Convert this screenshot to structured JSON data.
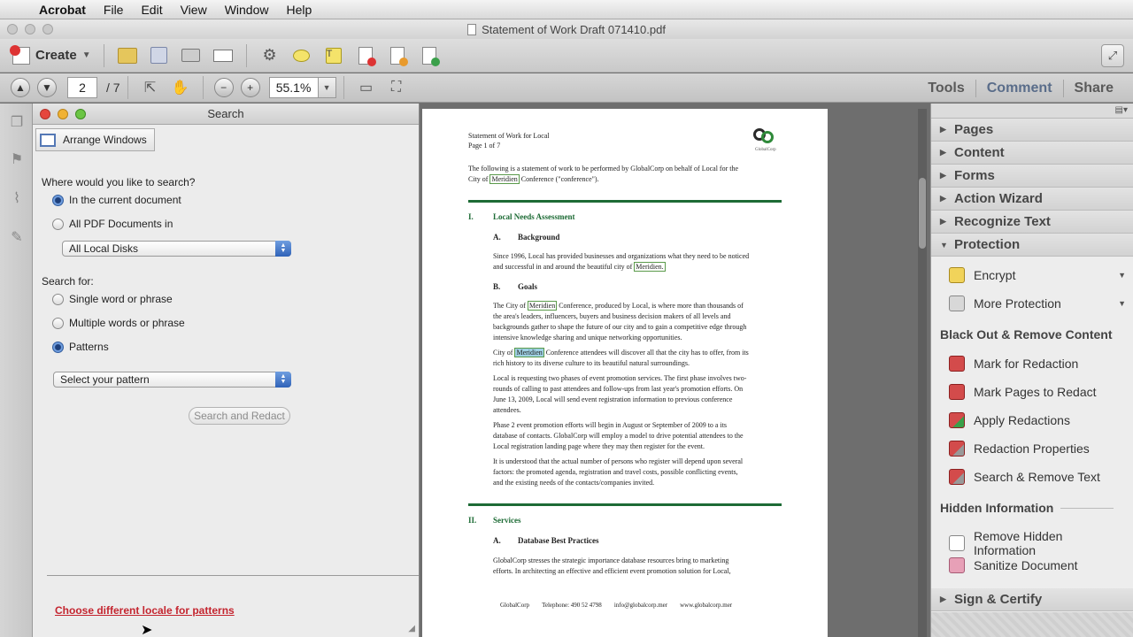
{
  "menubar": {
    "app": "Acrobat",
    "items": [
      "File",
      "Edit",
      "View",
      "Window",
      "Help"
    ]
  },
  "window": {
    "title": "Statement of Work Draft 071410.pdf"
  },
  "toolbar": {
    "create_label": "Create",
    "icons": [
      "folder-open-icon",
      "save-icon",
      "print-icon",
      "email-icon",
      "gear-icon",
      "comment-bubble-icon",
      "sign-pen-icon",
      "redact-doc-icon",
      "export-doc-icon",
      "combine-doc-icon"
    ]
  },
  "nav": {
    "current_page": "2",
    "total_pages": "/ 7",
    "zoom": "55.1%"
  },
  "tabs": {
    "tools": "Tools",
    "comment": "Comment",
    "share": "Share"
  },
  "search": {
    "title": "Search",
    "arrange_windows": "Arrange Windows",
    "where_label": "Where would you like to search?",
    "opt_current": "In the current document",
    "opt_all_pdf": "All PDF Documents in",
    "location_select": "All Local Disks",
    "search_for_label": "Search for:",
    "opt_single": "Single word or phrase",
    "opt_multiple": "Multiple words or phrase",
    "opt_patterns": "Patterns",
    "pattern_select": "Select your pattern",
    "search_redact_button": "Search and Redact",
    "locale_link": "Choose different locale for patterns"
  },
  "document": {
    "header_title": "Statement of Work for Local",
    "header_page": "Page 1 of 7",
    "logo_text": "GlobalCorp",
    "intro_1": "The following is a statement of work to be performed by GlobalCorp on behalf of Local for the",
    "intro_2a": "City of ",
    "intro_2_hl": "Meridien",
    "intro_2b": " Conference (\"conference\").",
    "sec1_num": "I.",
    "sec1_title": "Local Needs Assessment",
    "subA_num": "A.",
    "subA_title": "Background",
    "bg_1": "Since 1996, Local has provided businesses and organizations what they need to be noticed",
    "bg_2a": "and successful in and around the beautiful city of ",
    "bg_2_hl": "Meridien.",
    "subB_num": "B.",
    "subB_title": "Goals",
    "g1_a": "The City of ",
    "g1_hl": "Meridien",
    "g1_b": " Conference, produced by Local, is where more than thousands of",
    "g1_2": "the area's leaders, influencers, buyers and business decision makers of all levels and",
    "g1_3": "backgrounds gather to shape the future of our city and to gain a competitive edge through",
    "g1_4": "intensive knowledge sharing and unique networking opportunities.",
    "g2_a": "City of ",
    "g2_hl": "Meridien",
    "g2_b": " Conference attendees will discover all that the city has to offer, from its",
    "g2_2": "rich history to its diverse culture to its beautiful natural surroundings.",
    "g3_1": "Local is requesting two phases of event promotion services. The first phase involves two-",
    "g3_2": "rounds of calling to past attendees and follow-ups from last year's promotion efforts. On",
    "g3_3": "June 13, 2009, Local will send event registration information to previous conference",
    "g3_4": "attendees.",
    "g4_1": "Phase 2 event promotion efforts will begin in August or September of 2009 to a its",
    "g4_2": "database of contacts. GlobalCorp will employ a model to drive potential attendees to the",
    "g4_3": "Local registration landing page where they may then register for the event.",
    "g5_1": "It is understood that the actual number of persons who register will depend upon several",
    "g5_2": "factors: the promoted agenda, registration and travel costs, possible conflicting events,",
    "g5_3": "and the existing needs of the contacts/companies invited.",
    "sec2_num": "II.",
    "sec2_title": "Services",
    "sub2A_num": "A.",
    "sub2A_title": "Database Best Practices",
    "s1_1": "GlobalCorp stresses the strategic importance database resources bring to marketing",
    "s1_2": "efforts. In architecting an effective and efficient event promotion solution for Local,",
    "footer_company": "GlobalCorp",
    "footer_phone": "Telephone: 490 52 4798",
    "footer_email": "info@globalcorp.mer",
    "footer_web": "www.globalcorp.mer"
  },
  "tools_panel": {
    "sections_top": [
      "Pages",
      "Content",
      "Forms",
      "Action Wizard",
      "Recognize Text"
    ],
    "protection": "Protection",
    "encrypt": "Encrypt",
    "more_protection": "More Protection",
    "blackout_heading": "Black Out & Remove Content",
    "mark_redaction": "Mark for Redaction",
    "mark_pages": "Mark Pages to Redact",
    "apply_redactions": "Apply Redactions",
    "redaction_properties": "Redaction Properties",
    "search_remove": "Search & Remove Text",
    "hidden_heading": "Hidden Information",
    "remove_hidden": "Remove Hidden Information",
    "sanitize": "Sanitize Document",
    "sign_certify": "Sign & Certify"
  }
}
